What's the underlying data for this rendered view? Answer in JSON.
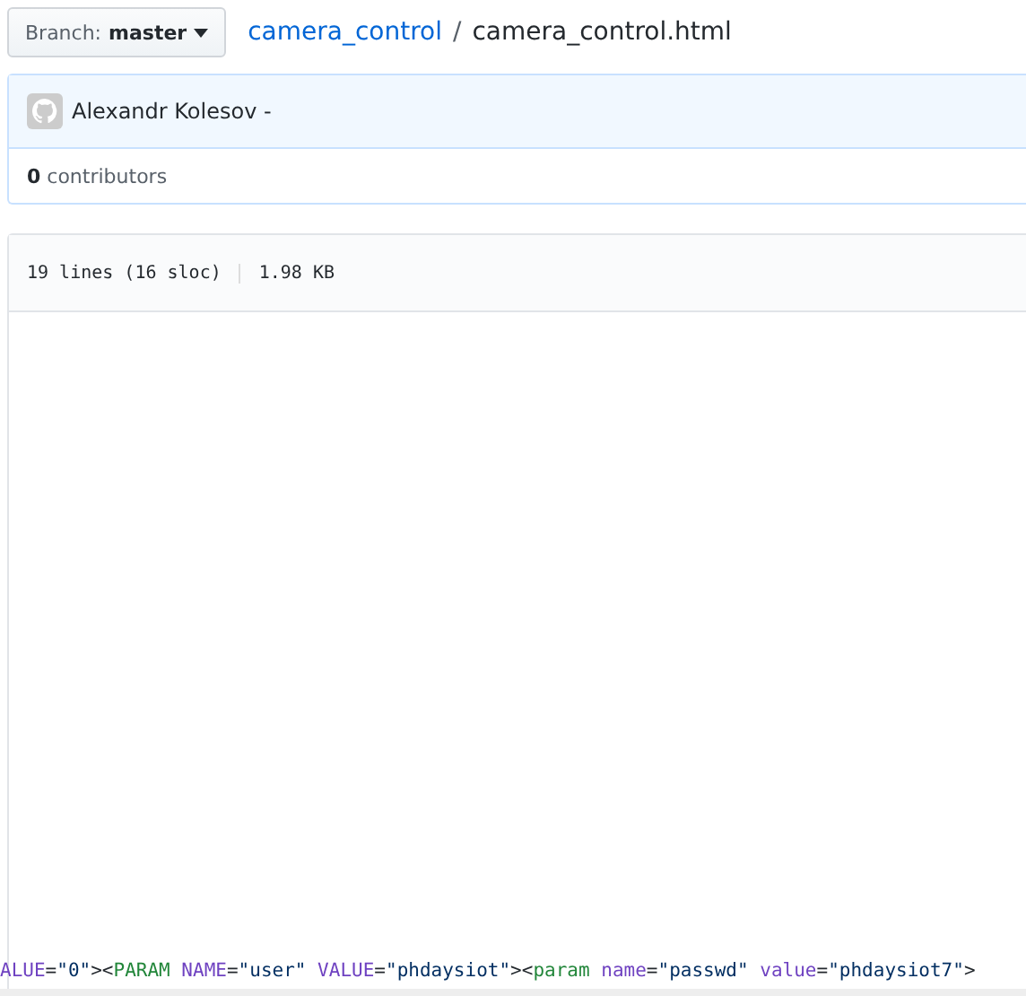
{
  "branch": {
    "label": "Branch:",
    "value": "master"
  },
  "breadcrumb": {
    "repo": "camera_control",
    "separator": "/",
    "file": "camera_control.html"
  },
  "commit": {
    "author": "Alexandr Kolesov -"
  },
  "contributors": {
    "count": "0",
    "label": "contributors"
  },
  "file_info": {
    "lines": "19 lines (16 sloc)",
    "size": "1.98 KB"
  },
  "code_line": [
    {
      "kind": "attr",
      "text": "ALUE"
    },
    {
      "kind": "punct",
      "text": "="
    },
    {
      "kind": "string",
      "text": "\"0\""
    },
    {
      "kind": "punct",
      "text": "><"
    },
    {
      "kind": "tag",
      "text": "PARAM"
    },
    {
      "kind": "attr",
      "text": " NAME"
    },
    {
      "kind": "punct",
      "text": "="
    },
    {
      "kind": "string",
      "text": "\"user\""
    },
    {
      "kind": "attr",
      "text": " VALUE"
    },
    {
      "kind": "punct",
      "text": "="
    },
    {
      "kind": "string",
      "text": "\"phdaysiot\""
    },
    {
      "kind": "punct",
      "text": "><"
    },
    {
      "kind": "tag",
      "text": "param"
    },
    {
      "kind": "attr",
      "text": " name"
    },
    {
      "kind": "punct",
      "text": "="
    },
    {
      "kind": "string",
      "text": "\"passwd\""
    },
    {
      "kind": "attr",
      "text": " value"
    },
    {
      "kind": "punct",
      "text": "="
    },
    {
      "kind": "string",
      "text": "\"phdaysiot7\""
    },
    {
      "kind": "punct",
      "text": ">"
    }
  ]
}
